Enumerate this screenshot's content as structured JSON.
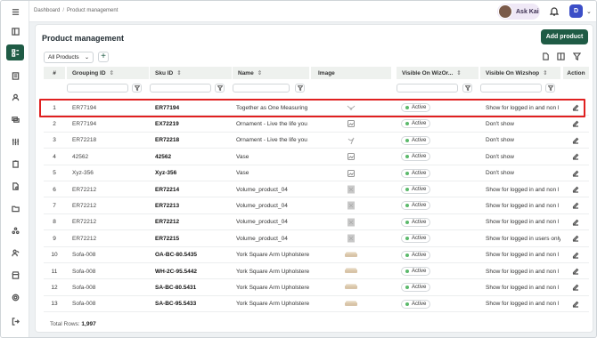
{
  "breadcrumb": {
    "root": "Dashboard",
    "separator": "/",
    "current": "Product management"
  },
  "user": {
    "name": "Ask Kai",
    "initial": "D"
  },
  "page": {
    "title": "Product management",
    "add_button": "Add product"
  },
  "toolbar": {
    "view_label": "All Products",
    "add_view": "+"
  },
  "table": {
    "columns": [
      "#",
      "Grouping ID",
      "Sku ID",
      "Name",
      "Image",
      "Visible On WizOr...",
      "Visible On Wizshop",
      "Action"
    ],
    "rows": [
      {
        "n": "1",
        "gid": "ER77194",
        "sku": "ER77194",
        "name": "Together as One Measuring S",
        "img": "necklace",
        "v1": "Active",
        "v2": "Show for logged in and non l"
      },
      {
        "n": "2",
        "gid": "ER77194",
        "sku": "EX72219",
        "name": "Ornament - Live the life you a",
        "img": "placeholder",
        "v1": "Active",
        "v2": "Don't show"
      },
      {
        "n": "3",
        "gid": "ER72218",
        "sku": "ER72218",
        "name": "Ornament - Live the life you a",
        "img": "bird",
        "v1": "Active",
        "v2": "Don't show"
      },
      {
        "n": "4",
        "gid": "42562",
        "sku": "42562",
        "name": "Vase",
        "img": "placeholder",
        "v1": "Active",
        "v2": "Don't show"
      },
      {
        "n": "5",
        "gid": "Xyz-356",
        "sku": "Xyz-356",
        "name": "Vase",
        "img": "placeholder",
        "v1": "Active",
        "v2": "Don't show"
      },
      {
        "n": "6",
        "gid": "ER72212",
        "sku": "ER72214",
        "name": "Volume_product_04",
        "img": "photo",
        "v1": "Active",
        "v2": "Show for logged in and non l"
      },
      {
        "n": "7",
        "gid": "ER72212",
        "sku": "ER72213",
        "name": "Volume_product_04",
        "img": "photo",
        "v1": "Active",
        "v2": "Show for logged in and non l"
      },
      {
        "n": "8",
        "gid": "ER72212",
        "sku": "ER72212",
        "name": "Volume_product_04",
        "img": "photo",
        "v1": "Active",
        "v2": "Show for logged in and non l"
      },
      {
        "n": "9",
        "gid": "ER72212",
        "sku": "ER72215",
        "name": "Volume_product_04",
        "img": "photo",
        "v1": "Active",
        "v2": "Show for logged in users only"
      },
      {
        "n": "10",
        "gid": "Sofa-008",
        "sku": "OA-BC-80.5435",
        "name": "York Square Arm Upholstered",
        "img": "sofa",
        "v1": "Active",
        "v2": "Show for logged in and non l"
      },
      {
        "n": "11",
        "gid": "Sofa-008",
        "sku": "WH-2C-95.5442",
        "name": "York Square Arm Upholstered",
        "img": "sofa",
        "v1": "Active",
        "v2": "Show for logged in and non l"
      },
      {
        "n": "12",
        "gid": "Sofa-008",
        "sku": "SA-BC-80.5431",
        "name": "York Square Arm Upholstered",
        "img": "sofa",
        "v1": "Active",
        "v2": "Show for logged in and non l"
      },
      {
        "n": "13",
        "gid": "Sofa-008",
        "sku": "SA-BC-95.5433",
        "name": "York Square Arm Upholstered",
        "img": "sofa",
        "v1": "Active",
        "v2": "Show for logged in and non l"
      }
    ]
  },
  "footer": {
    "label": "Total Rows:",
    "value": "1,997"
  },
  "colors": {
    "brand": "#1f5b45",
    "highlight": "#e02020",
    "active_dot": "#5bb96b"
  }
}
